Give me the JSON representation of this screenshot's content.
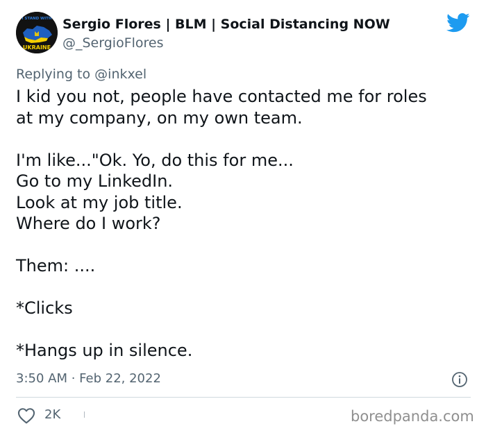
{
  "author": {
    "display_name": "Sergio Flores | BLM | Social Distancing NOW",
    "handle": "@_SergioFlores",
    "avatar_icon": "ukraine-map-avatar",
    "avatar_texts": [
      "I STAND WITH",
      "UKRAINE"
    ]
  },
  "reply": {
    "prefix": "Replying to",
    "mention": "@inkxel"
  },
  "tweet": {
    "lines": [
      "I kid you not, people have contacted me for roles",
      "at my company, on my own team.",
      "",
      "I'm like...\"Ok. Yo, do this for me...",
      "Go to my LinkedIn.",
      "Look at my job title.",
      "Where do I work?",
      "",
      "Them: ....",
      "",
      "*Clicks",
      "",
      "*Hangs up in silence."
    ]
  },
  "meta": {
    "timestamp": "3:50 AM · Feb 22, 2022"
  },
  "engagement": {
    "likes": "2K",
    "like_icon": "heart-icon"
  },
  "watermark": "boredpanda.com",
  "colors": {
    "text": "#0f1419",
    "secondary": "#536471",
    "twitter_blue": "#1d9bf0",
    "ukraine_blue": "#1f5fbf",
    "ukraine_yellow": "#f5d000"
  }
}
